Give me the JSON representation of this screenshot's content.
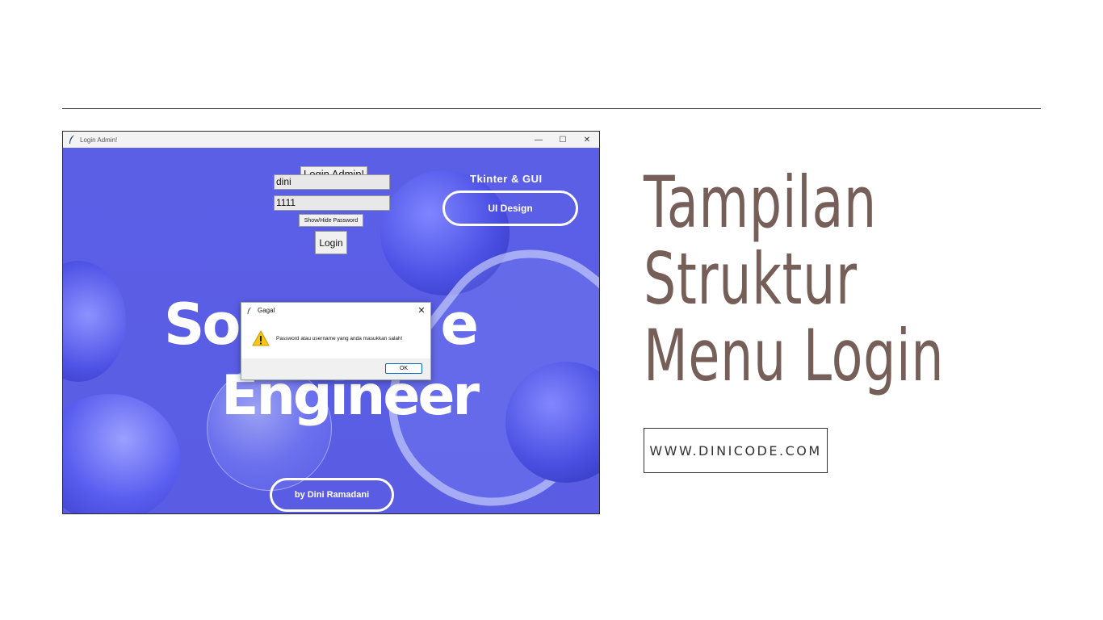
{
  "window": {
    "title": "Login Admin!",
    "controls": {
      "minimize": "—",
      "maximize": "☐",
      "close": "✕"
    }
  },
  "app": {
    "heading": "Login Admin!",
    "username_value": "dini",
    "password_value": "1111",
    "show_hide_label": "Show/Hide Password",
    "login_label": "Login"
  },
  "background": {
    "tag": "Tkinter & GUI",
    "pill_top": "UI Design",
    "big_text_line1_left": "So",
    "big_text_line1_right": "e",
    "big_text_line2": "Engineer",
    "pill_bottom": "by Dini Ramadani"
  },
  "dialog": {
    "title": "Gagal",
    "close": "✕",
    "message": "Password atau username yang anda masukkan salah!",
    "ok_label": "OK",
    "icon": "warning-icon"
  },
  "headline": {
    "line1": "Tampilan",
    "line2": "Struktur",
    "line3": "Menu Login"
  },
  "site": "WWW.DINICODE.COM",
  "colors": {
    "accent_text": "#765f58",
    "window_bg": "#5a5ee6"
  }
}
